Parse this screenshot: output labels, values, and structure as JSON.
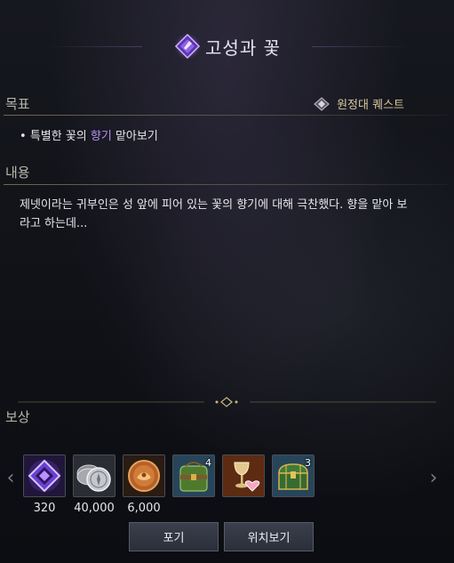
{
  "title": "고성과 꽃",
  "objective": {
    "label": "목표",
    "quest_type": "원정대 퀘스트",
    "text_before": "특별한 꽃의 ",
    "highlight": "향기",
    "text_after": " 맡아보기",
    "highlight_color": "#b78ff0"
  },
  "content": {
    "label": "내용",
    "text": "제넷이라는 귀부인은 성 앞에 피어 있는 꽃의 향기에 대해 극찬했다. 향을 맡아 보라고 하는데..."
  },
  "rewards": {
    "label": "보상",
    "items": [
      {
        "icon": "purple-crystal-icon",
        "amount": "320",
        "count": ""
      },
      {
        "icon": "silver-coins-icon",
        "amount": "40,000",
        "count": ""
      },
      {
        "icon": "bronze-coin-icon",
        "amount": "6,000",
        "count": ""
      },
      {
        "icon": "green-bag-icon",
        "amount": "",
        "count": "4"
      },
      {
        "icon": "goblet-heart-icon",
        "amount": "",
        "count": ""
      },
      {
        "icon": "green-chest-icon",
        "amount": "",
        "count": "3"
      }
    ]
  },
  "buttons": {
    "abandon": "포기",
    "locate": "위치보기"
  },
  "colors": {
    "accent_purple": "#8f5fe0",
    "gold_divider": "#beaa78"
  }
}
